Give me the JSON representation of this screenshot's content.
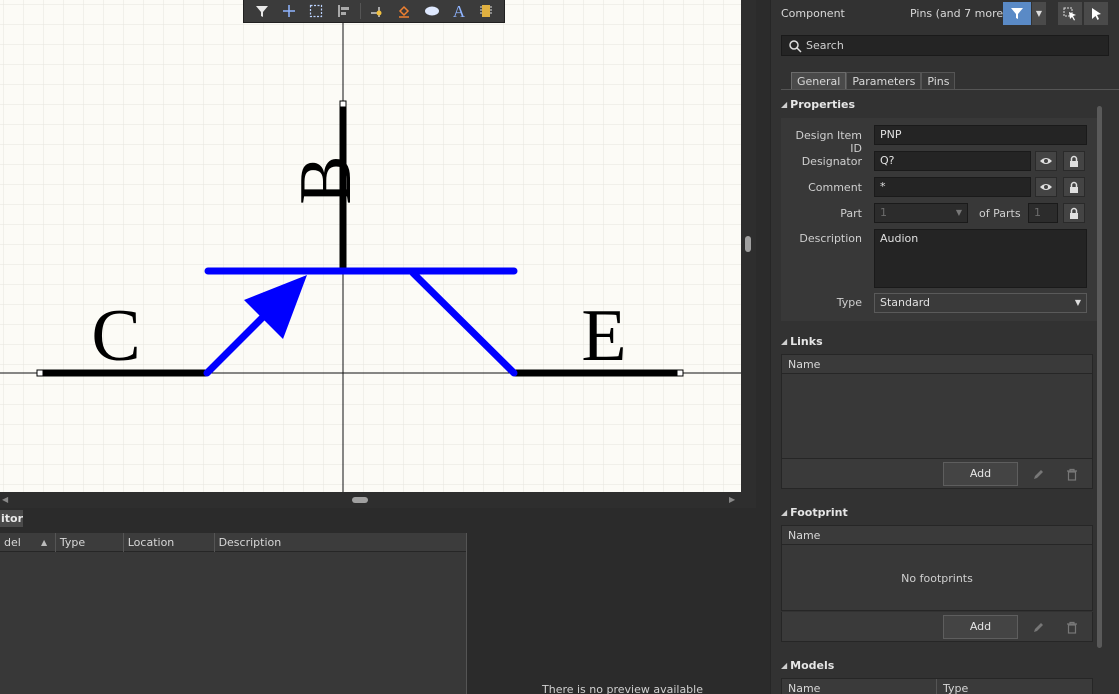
{
  "canvas": {
    "labels": {
      "base": "B",
      "collector": "C",
      "emitter": "E"
    }
  },
  "toolbar": {
    "tools": [
      "filter-icon",
      "add-crosshair-icon",
      "select-rect-icon",
      "align-icon",
      "place-pin-icon",
      "fill-icon",
      "ellipse-icon",
      "text-icon",
      "component-icon"
    ]
  },
  "lower_panel": {
    "tab_label": "itor",
    "columns": [
      "del",
      "Type",
      "Location",
      "Description"
    ],
    "preview_text": "There is no preview available"
  },
  "properties": {
    "header": {
      "title": "Component",
      "filter_label": "Pins (and 7 more)"
    },
    "search_placeholder": "Search",
    "tabs": [
      "General",
      "Parameters",
      "Pins"
    ],
    "section_properties": "Properties",
    "design_item_id": {
      "label": "Design Item ID",
      "value": "PNP"
    },
    "designator": {
      "label": "Designator",
      "value": "Q?"
    },
    "comment": {
      "label": "Comment",
      "value": "*"
    },
    "part": {
      "label": "Part",
      "value": "1",
      "of_parts_label": "of Parts",
      "of_parts_value": "1"
    },
    "description": {
      "label": "Description",
      "value": "Audion"
    },
    "type": {
      "label": "Type",
      "value": "Standard"
    },
    "links": {
      "title": "Links",
      "column": "Name",
      "add_label": "Add"
    },
    "footprint": {
      "title": "Footprint",
      "column": "Name",
      "empty_text": "No footprints",
      "add_label": "Add"
    },
    "models": {
      "title": "Models",
      "columns": [
        "Name",
        "Type"
      ]
    }
  },
  "colors": {
    "wire_blue": "#0000ff",
    "accent": "#5a8ac6"
  }
}
